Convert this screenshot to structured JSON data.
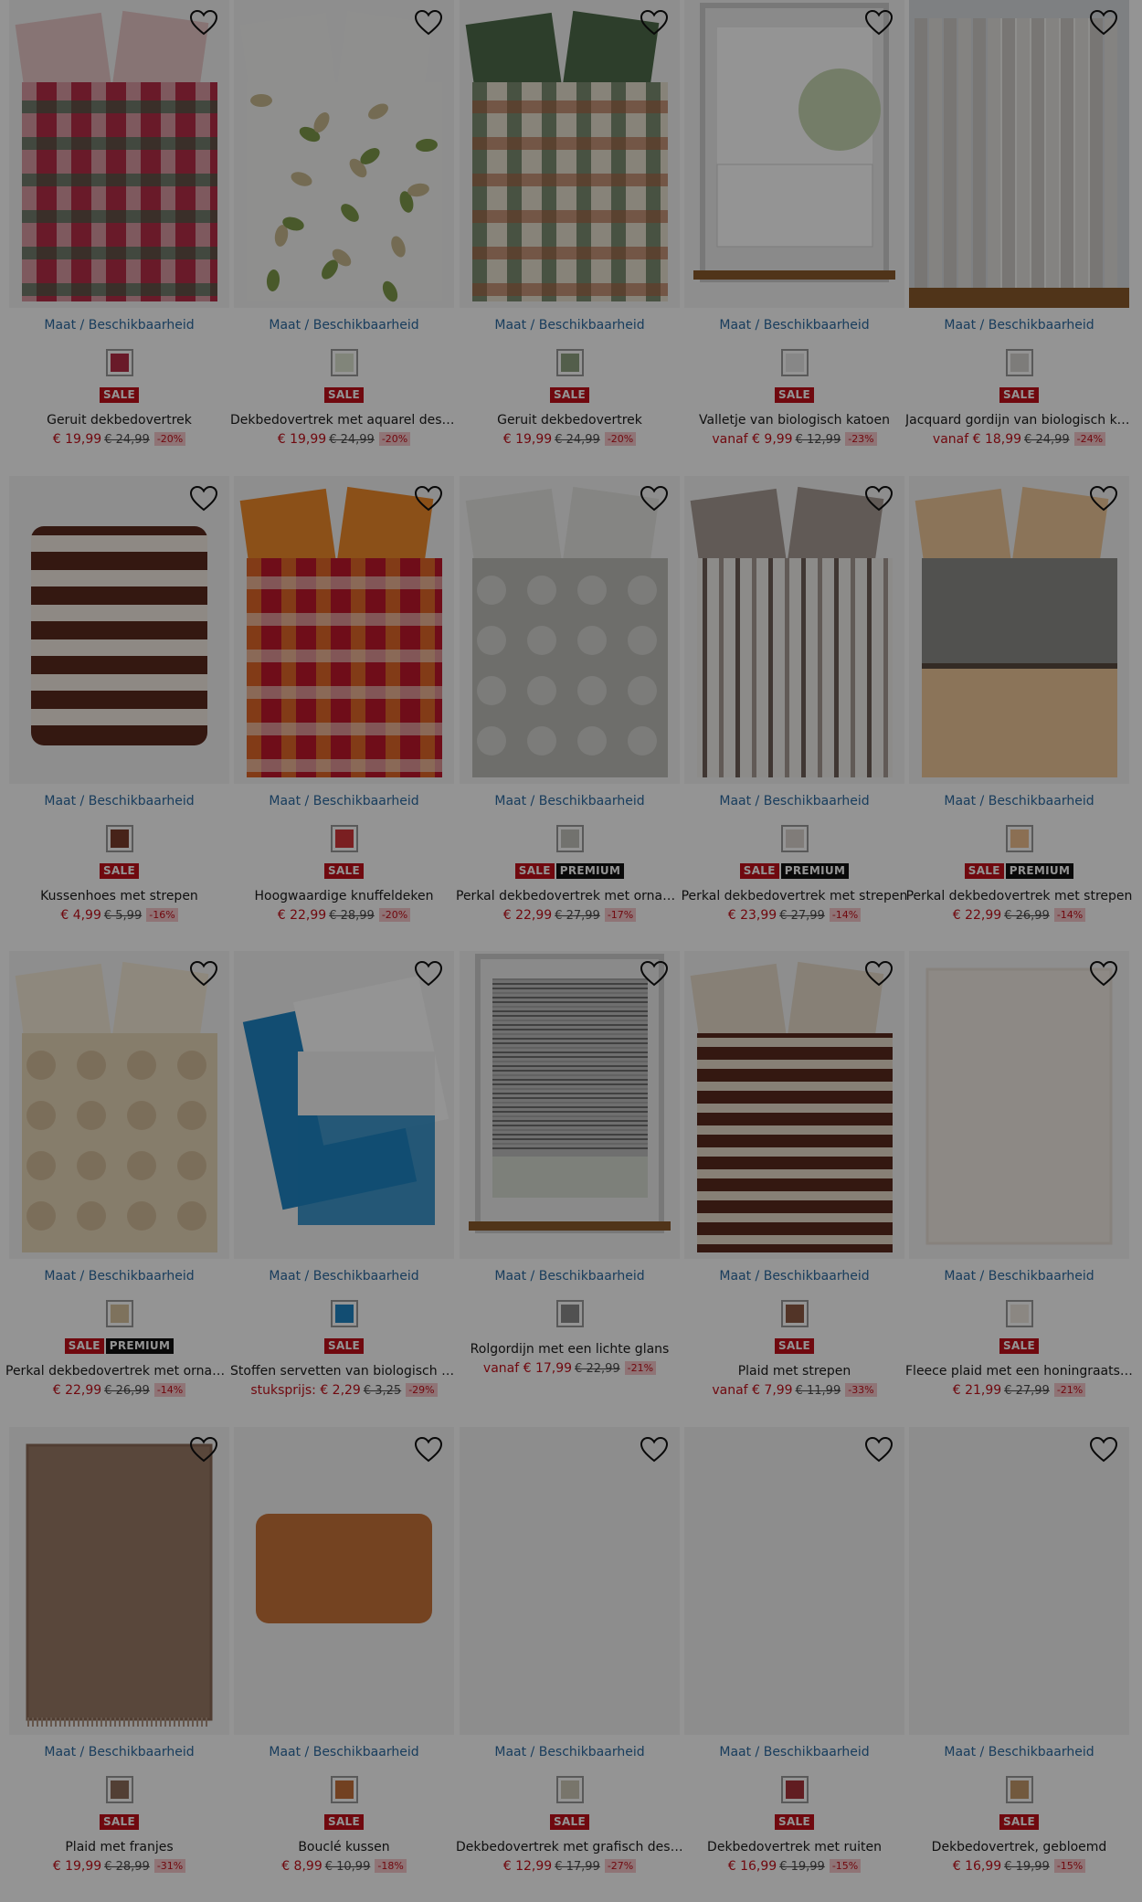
{
  "products": [
    {
      "size_link": "Maat / Beschikbaarheid",
      "badges": [
        "SALE"
      ],
      "title": "Geruit dekbedovertrek",
      "price_prefix": "",
      "price": "€ 19,99",
      "old_price": "€ 24,99",
      "discount": "-20%",
      "colors": [
        "#b52d47",
        "#e8c9c9",
        "#2f6b4a"
      ],
      "art": "plaid",
      "swatch": "#b52d47"
    },
    {
      "size_link": "Maat / Beschikbaarheid",
      "badges": [
        "SALE"
      ],
      "title": "Dekbedovertrek met aquarel design",
      "price_prefix": "",
      "price": "€ 19,99",
      "old_price": "€ 24,99",
      "discount": "-20%",
      "colors": [
        "#f7f7f4",
        "#7f9a4a",
        "#c9b98f"
      ],
      "art": "leaves",
      "swatch": "#dfe6d2"
    },
    {
      "size_link": "Maat / Beschikbaarheid",
      "badges": [
        "SALE"
      ],
      "title": "Geruit dekbedovertrek",
      "price_prefix": "",
      "price": "€ 19,99",
      "old_price": "€ 24,99",
      "discount": "-20%",
      "colors": [
        "#e9e2d0",
        "#4f6b4a",
        "#b06040"
      ],
      "art": "plaid",
      "swatch": "#8fa382"
    },
    {
      "size_link": "Maat / Beschikbaarheid",
      "badges": [
        "SALE"
      ],
      "title": "Valletje van biologisch katoen",
      "price_prefix": "vanaf ",
      "price": "€ 9,99",
      "old_price": "€ 12,99",
      "discount": "-23%",
      "colors": [
        "#ffffff",
        "#e6e6e6",
        "#8b5a2b"
      ],
      "art": "window",
      "swatch": "#e9e9e9"
    },
    {
      "size_link": "Maat / Beschikbaarheid",
      "badges": [
        "SALE"
      ],
      "title": "Jacquard gordijn van biologisch katoen",
      "price_prefix": "vanaf ",
      "price": "€ 18,99",
      "old_price": "€ 24,99",
      "discount": "-24%",
      "colors": [
        "#e4e2df",
        "#cfccc8",
        "#8b5a2b"
      ],
      "art": "curtain",
      "swatch": "#d8d6d2"
    },
    {
      "size_link": "Maat / Beschikbaarheid",
      "badges": [
        "SALE"
      ],
      "title": "Kussenhoes met strepen",
      "price_prefix": "",
      "price": "€ 4,99",
      "old_price": "€ 5,99",
      "discount": "-16%",
      "colors": [
        "#f5ede4",
        "#5a2a1e",
        "#b08a6c"
      ],
      "art": "pillow-stripes",
      "swatch": "#7a3d2c"
    },
    {
      "size_link": "Maat / Beschikbaarheid",
      "badges": [
        "SALE"
      ],
      "title": "Hoogwaardige knuffeldeken",
      "price_prefix": "",
      "price": "€ 22,99",
      "old_price": "€ 28,99",
      "discount": "-20%",
      "colors": [
        "#c0172b",
        "#f08a2a",
        "#f7e9e0"
      ],
      "art": "plaid-red",
      "swatch": "#d3363a"
    },
    {
      "size_link": "Maat / Beschikbaarheid",
      "badges": [
        "SALE",
        "PREMIUM"
      ],
      "title": "Perkal dekbedovertrek met ornamenten",
      "price_prefix": "",
      "price": "€ 22,99",
      "old_price": "€ 27,99",
      "discount": "-17%",
      "colors": [
        "#bdbdb8",
        "#e6e6e2",
        "#9a9a94"
      ],
      "art": "ornament",
      "swatch": "#c4c4be"
    },
    {
      "size_link": "Maat / Beschikbaarheid",
      "badges": [
        "SALE",
        "PREMIUM"
      ],
      "title": "Perkal dekbedovertrek met strepen",
      "price_prefix": "",
      "price": "€ 23,99",
      "old_price": "€ 27,99",
      "discount": "-14%",
      "colors": [
        "#f2efec",
        "#a89c94",
        "#6e6058"
      ],
      "art": "stripes-v",
      "swatch": "#ddd6d1"
    },
    {
      "size_link": "Maat / Beschikbaarheid",
      "badges": [
        "SALE",
        "PREMIUM"
      ],
      "title": "Perkal dekbedovertrek met strepen",
      "price_prefix": "",
      "price": "€ 22,99",
      "old_price": "€ 26,99",
      "discount": "-14%",
      "colors": [
        "#f0c89a",
        "#8c8c88",
        "#d8d6d2"
      ],
      "art": "peach",
      "swatch": "#efc08f"
    },
    {
      "size_link": "Maat / Beschikbaarheid",
      "badges": [
        "SALE",
        "PREMIUM"
      ],
      "title": "Perkal dekbedovertrek met ornamenten",
      "price_prefix": "",
      "price": "€ 22,99",
      "old_price": "€ 26,99",
      "discount": "-14%",
      "colors": [
        "#e7d7b8",
        "#c9ae88",
        "#f4ead8"
      ],
      "art": "beige-pattern",
      "swatch": "#d9c4a0"
    },
    {
      "size_link": "Maat / Beschikbaarheid",
      "badges": [
        "SALE"
      ],
      "title": "Stoffen servetten van biologisch katoen",
      "price_prefix": "stuksprijs: ",
      "price": "€ 2,29",
      "old_price": "€ 3,25",
      "discount": "-29%",
      "colors": [
        "#1f86c4",
        "#ffffff",
        "#dfe7ee"
      ],
      "art": "napkins",
      "swatch": "#1f86c4"
    },
    {
      "size_link": "Maat / Beschikbaarheid",
      "badges": [],
      "title": "Rolgordijn met een lichte glans",
      "price_prefix": "vanaf ",
      "price": "€ 17,99",
      "old_price": "€ 22,99",
      "discount": "-21%",
      "colors": [
        "#7a7a7a",
        "#d0d0d0",
        "#8b5a2b"
      ],
      "art": "blind",
      "swatch": "#8c8c8c"
    },
    {
      "size_link": "Maat / Beschikbaarheid",
      "badges": [
        "SALE"
      ],
      "title": "Plaid met strepen",
      "price_prefix": "vanaf ",
      "price": "€ 7,99",
      "old_price": "€ 11,99",
      "discount": "-33%",
      "colors": [
        "#5a2a1e",
        "#e8dccb",
        "#9c6b4e"
      ],
      "art": "blanket-stripes",
      "swatch": "#8e5a44"
    },
    {
      "size_link": "Maat / Beschikbaarheid",
      "badges": [
        "SALE"
      ],
      "title": "Fleece plaid met een honingraatstructuur",
      "price_prefix": "",
      "price": "€ 21,99",
      "old_price": "€ 27,99",
      "discount": "-21%",
      "colors": [
        "#f3ede6",
        "#e9e1d7",
        "#d9cfc3"
      ],
      "art": "fleece",
      "swatch": "#efe8e0"
    },
    {
      "size_link": "Maat / Beschikbaarheid",
      "badges": [
        "SALE"
      ],
      "title": "Plaid met franjes",
      "price_prefix": "",
      "price": "€ 19,99",
      "old_price": "€ 28,99",
      "discount": "-31%",
      "colors": [
        "#9a7a66",
        "#8a6a56",
        "#b09482"
      ],
      "art": "fringe",
      "swatch": "#8e6d5a"
    },
    {
      "size_link": "Maat / Beschikbaarheid",
      "badges": [
        "SALE"
      ],
      "title": "Bouclé kussen",
      "price_prefix": "",
      "price": "€ 8,99",
      "old_price": "€ 10,99",
      "discount": "-18%",
      "colors": [
        "#c8743a",
        "#a85a26",
        "#f2f2f2"
      ],
      "art": "boucle",
      "swatch": "#c4713a"
    },
    {
      "size_link": "Maat / Beschikbaarheid",
      "badges": [
        "SALE"
      ],
      "title": "Dekbedovertrek met grafisch design",
      "price_prefix": "",
      "price": "€ 12,99",
      "old_price": "€ 17,99",
      "discount": "-27%",
      "colors": [
        "#f3f3f3",
        "#f3f3f3",
        "#f3f3f3"
      ],
      "art": "blank",
      "swatch": "#cfcab8"
    },
    {
      "size_link": "Maat / Beschikbaarheid",
      "badges": [
        "SALE"
      ],
      "title": "Dekbedovertrek met ruiten",
      "price_prefix": "",
      "price": "€ 16,99",
      "old_price": "€ 19,99",
      "discount": "-15%",
      "colors": [
        "#f3f3f3",
        "#f3f3f3",
        "#f3f3f3"
      ],
      "art": "blank",
      "swatch": "#a8323a"
    },
    {
      "size_link": "Maat / Beschikbaarheid",
      "badges": [
        "SALE"
      ],
      "title": "Dekbedovertrek, gebloemd",
      "price_prefix": "",
      "price": "€ 16,99",
      "old_price": "€ 19,99",
      "discount": "-15%",
      "colors": [
        "#f3f3f3",
        "#f3f3f3",
        "#f3f3f3"
      ],
      "art": "blank",
      "swatch": "#c49a6c"
    }
  ]
}
